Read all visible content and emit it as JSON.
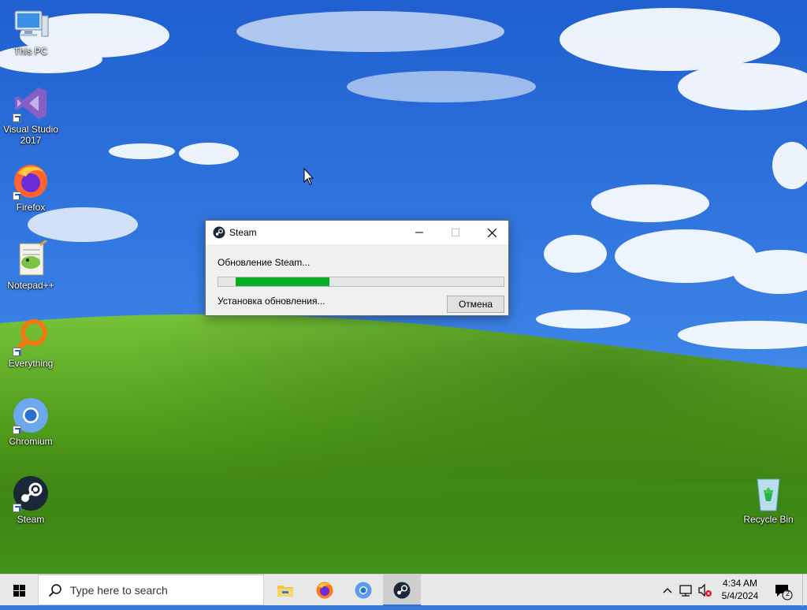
{
  "desktop": {
    "icons": [
      {
        "label": "This PC",
        "icon": "this-pc-icon"
      },
      {
        "label": "Visual Studio 2017",
        "icon": "visual-studio-icon"
      },
      {
        "label": "Firefox",
        "icon": "firefox-icon"
      },
      {
        "label": "Notepad++",
        "icon": "notepad-plus-plus-icon"
      },
      {
        "label": "Everything",
        "icon": "everything-search-icon"
      },
      {
        "label": "Chromium",
        "icon": "chromium-icon"
      },
      {
        "label": "Steam",
        "icon": "steam-icon"
      },
      {
        "label": "Recycle Bin",
        "icon": "recycle-bin-icon"
      }
    ]
  },
  "dialog": {
    "title": "Steam",
    "heading": "Обновление Steam...",
    "status": "Установка обновления...",
    "cancel_label": "Отмена",
    "progress_percent": 35,
    "progress_color": "#06b025"
  },
  "taskbar": {
    "search_placeholder": "Type here to search",
    "pinned": [
      "file-explorer-icon",
      "firefox-icon",
      "chromium-icon",
      "steam-icon"
    ],
    "active_app": "steam-icon",
    "clock": {
      "time": "4:34 AM",
      "date": "5/4/2024"
    },
    "notification_count": "2"
  },
  "colors": {
    "accent": "#2a6fd6",
    "desktop_sky": "#2f6fd0",
    "hill_green": "#5ea81f"
  }
}
